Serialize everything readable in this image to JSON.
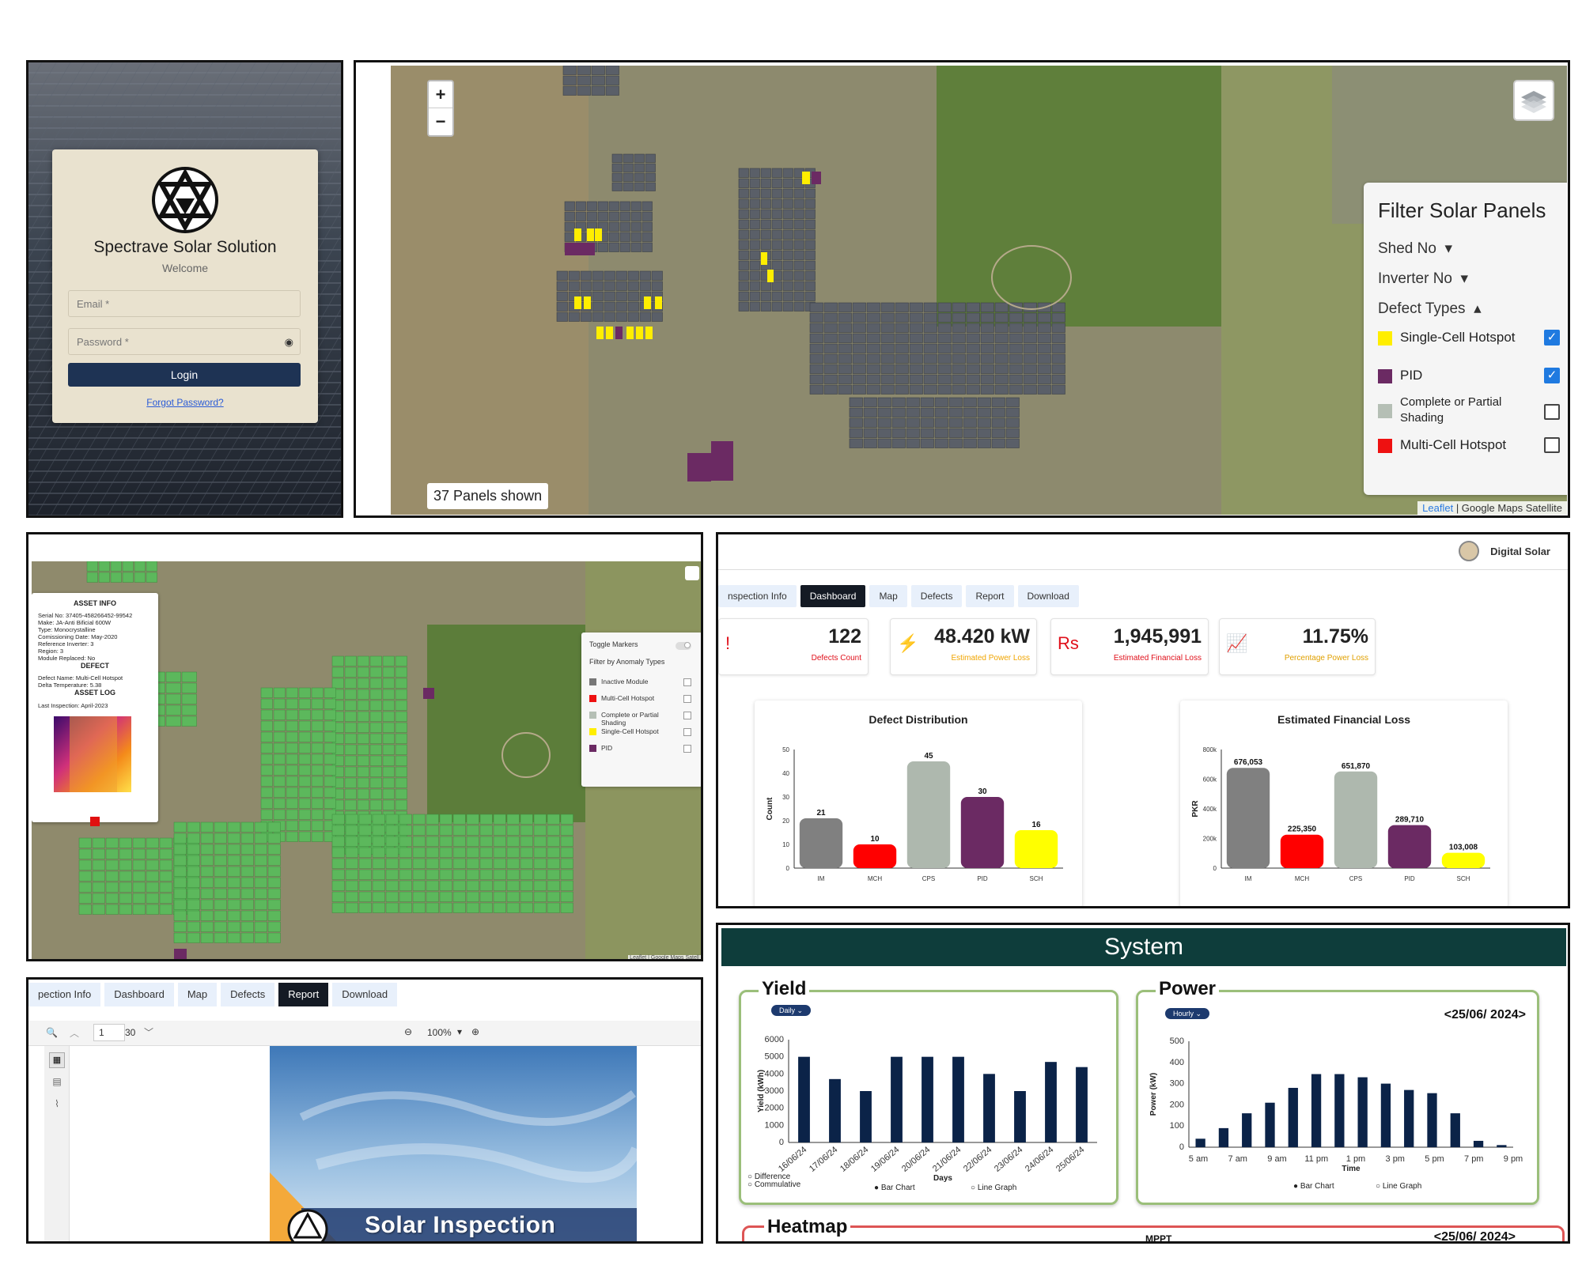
{
  "login": {
    "brand": "Spectrave Solar Solution",
    "welcome": "Welcome",
    "email_placeholder": "Email *",
    "password_placeholder": "Password *",
    "login_label": "Login",
    "forgot_label": "Forgot Password?"
  },
  "map1": {
    "zoom_in": "+",
    "zoom_out": "−",
    "panels_shown": "37 Panels shown",
    "attribution_leaflet": "Leaflet",
    "attribution_rest": " | Google Maps Satellite",
    "filter": {
      "title": "Filter Solar Panels",
      "shed_no": "Shed No",
      "inverter_no": "Inverter No",
      "defect_types": "Defect Types",
      "items": [
        {
          "label": "Single-Cell Hotspot",
          "color": "#ffee00",
          "checked": true
        },
        {
          "label": "PID",
          "color": "#6b2a63",
          "checked": true
        },
        {
          "label": "Complete or Partial Shading",
          "color": "#b5bfb5",
          "checked": false
        },
        {
          "label": "Multi-Cell Hotspot",
          "color": "#ee1111",
          "checked": false
        }
      ]
    }
  },
  "map2": {
    "asset_info": {
      "title": "ASSET INFO",
      "serial": "Serial No: 37405-458266452-99542",
      "make": "Make: JA-Anti Bificial 600W",
      "type": "Type: Monocrystalline",
      "commissioning": "Comissioning Date: May-2020",
      "ref_inverter": "Reference Inverter: 3",
      "region": "Region: 3",
      "replaced": "Module Replaced: No",
      "defect_title": "DEFECT",
      "defect_name": "Defect Name: Multi-Cell Hotspot",
      "delta_temp": "Delta Temperature: 5.38",
      "log_title": "ASSET LOG",
      "last_inspection": "Last Inspection: April-2023"
    },
    "anomaly": {
      "toggle_label": "Toggle Markers",
      "filter_label": "Filter by Anomaly Types",
      "items": [
        {
          "label": "Inactive Module",
          "color": "#777777"
        },
        {
          "label": "Multi-Cell Hotspot",
          "color": "#ee1111"
        },
        {
          "label": "Complete or Partial Shading",
          "color": "#b5bfb5"
        },
        {
          "label": "Single-Cell Hotspot",
          "color": "#ffee00"
        },
        {
          "label": "PID",
          "color": "#6b2a63"
        }
      ]
    },
    "attribution": "Leaflet | Google Maps Satell"
  },
  "dashboard": {
    "user": "Digital Solar",
    "tabs": [
      "nspection Info",
      "Dashboard",
      "Map",
      "Defects",
      "Report",
      "Download"
    ],
    "active_tab": "Dashboard",
    "kpis": [
      {
        "value": "122",
        "label": "Defects Count",
        "color": "#e0101b",
        "icon": "!"
      },
      {
        "value": "48.420 kW",
        "label": "Estimated Power Loss",
        "color": "#f0a500",
        "icon": "⚡"
      },
      {
        "value": "1,945,991",
        "label": "Estimated Financial Loss",
        "color": "#e0101b",
        "icon": "Rs"
      },
      {
        "value": "11.75%",
        "label": "Percentage Power Loss",
        "color": "#e0a000",
        "icon": "📈"
      }
    ]
  },
  "report": {
    "tabs": [
      "pection Info",
      "Dashboard",
      "Map",
      "Defects",
      "Report",
      "Download"
    ],
    "active_tab": "Report",
    "page_current": "1",
    "page_total": "30",
    "zoom": "100%",
    "title": "Solar Inspection Report"
  },
  "system": {
    "title": "System",
    "yield_title": "Yield",
    "yield_pill": "Daily",
    "power_title": "Power",
    "power_pill": "Hourly",
    "power_date": "<25/06/ 2024>",
    "yield_legend_diff": "Difference",
    "yield_legend_cum": "Commulative",
    "bar_chart": "Bar Chart",
    "line_graph": "Line Graph",
    "heatmap_title": "Heatmap",
    "heatmap_mppt": "MPPT",
    "heatmap_date": "<25/06/ 2024>"
  },
  "chart_data": [
    {
      "type": "bar",
      "title": "Defect Distribution",
      "ylabel": "Count",
      "categories": [
        "IM",
        "MCH",
        "CPS",
        "PID",
        "SCH"
      ],
      "values": [
        21,
        10,
        45,
        30,
        16
      ],
      "colors": [
        "#808080",
        "#ff0000",
        "#aeb8ae",
        "#6b2a63",
        "#ffff00"
      ],
      "ylim": [
        0,
        50
      ],
      "yticks": [
        0,
        10,
        20,
        30,
        40,
        50
      ]
    },
    {
      "type": "bar",
      "title": "Estimated Financial Loss",
      "ylabel": "PKR",
      "categories": [
        "IM",
        "MCH",
        "CPS",
        "PID",
        "SCH"
      ],
      "values": [
        676053,
        225350,
        651870,
        289710,
        103008
      ],
      "labels": [
        "676,053",
        "225,350",
        "651,870",
        "289,710",
        "103,008"
      ],
      "colors": [
        "#808080",
        "#ff0000",
        "#aeb8ae",
        "#6b2a63",
        "#ffff00"
      ],
      "ylim": [
        0,
        800000
      ],
      "yticks": [
        0,
        200000,
        400000,
        600000,
        800000
      ],
      "ytick_labels": [
        "0",
        "200k",
        "400k",
        "600k",
        "800k"
      ]
    },
    {
      "type": "bar",
      "title": "Yield",
      "xlabel": "Days",
      "ylabel": "Yield (kWh)",
      "categories": [
        "16/06/24",
        "17/06/24",
        "18/06/24",
        "19/06/24",
        "20/06/24",
        "21/06/24",
        "22/06/24",
        "23/06/24",
        "24/06/24",
        "25/06/24"
      ],
      "values": [
        5000,
        3700,
        3000,
        5000,
        5000,
        5000,
        4000,
        3000,
        4700,
        4400
      ],
      "ylim": [
        0,
        6000
      ],
      "yticks": [
        0,
        1000,
        2000,
        3000,
        4000,
        5000,
        6000
      ]
    },
    {
      "type": "bar",
      "title": "Power",
      "xlabel": "Time",
      "ylabel": "Power (kW)",
      "categories": [
        "5 am",
        "7 am",
        "9 am",
        "11 pm",
        "1 pm",
        "3 pm",
        "5 pm",
        "7 pm",
        "9 pm"
      ],
      "values": [
        40,
        90,
        160,
        210,
        280,
        345,
        345,
        330,
        300,
        270,
        255,
        160,
        30,
        10
      ],
      "ylim": [
        0,
        500
      ],
      "yticks": [
        0,
        100,
        200,
        300,
        400,
        500
      ]
    }
  ]
}
